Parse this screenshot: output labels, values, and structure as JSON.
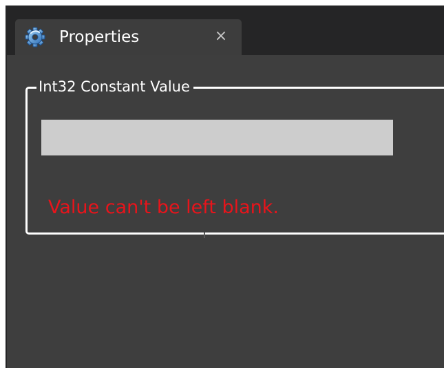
{
  "tab": {
    "icon": "gear-icon",
    "title": "Properties",
    "close_label": "×"
  },
  "group": {
    "legend": "Int32 Constant Value"
  },
  "value_input": {
    "value": ""
  },
  "validation": {
    "error_message": "Value can't be left blank.",
    "error_color": "#e8141b"
  },
  "colors": {
    "window_background": "#252526",
    "tab_background": "#3d3d3d",
    "panel_background": "#3e3e3e",
    "input_background": "#cdcdcd",
    "group_border": "#ffffff"
  }
}
